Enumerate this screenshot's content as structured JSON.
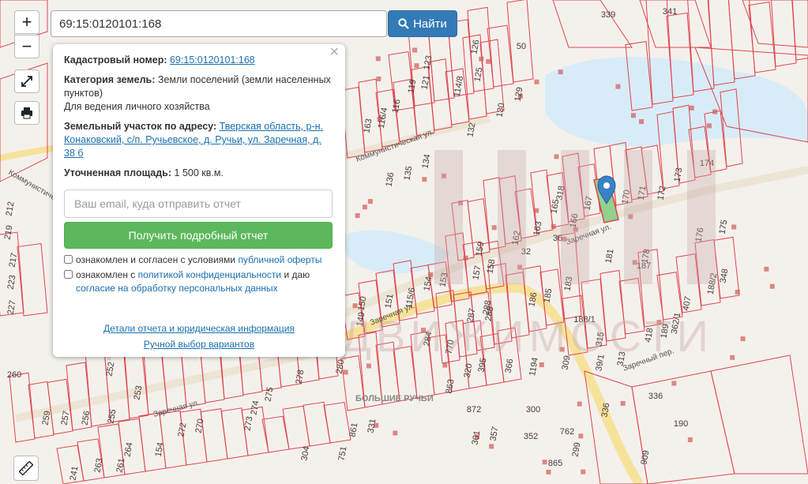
{
  "search": {
    "value": "69:15:0120101:168",
    "button_label": "Найти"
  },
  "controls": {
    "zoom_in": "+",
    "zoom_out": "−"
  },
  "popup": {
    "close_label": "×",
    "cadastral_label": "Кадастровый номер:",
    "cadastral_value": "69:15:0120101:168",
    "category_label": "Категория земель:",
    "category_value": "Земли поселений (земли населенных пунктов)",
    "use_value": "Для ведения личного хозяйства",
    "address_label": "Земельный участок по адресу:",
    "address_value": "Тверская область, р-н. Конаковский, с/п. Ручьевское, д. Ручьи, ул. Заречная, д. 38 б",
    "area_label": "Уточненная площадь:",
    "area_value": "1 500 кв.м.",
    "email_placeholder": "Ваш email, куда отправить отчет",
    "report_button": "Получить подробный отчет",
    "consent1_text": "ознакомлен и согласен с условиями",
    "consent1_link": "публичной оферты",
    "consent2_text": "ознакомлен с",
    "consent2_link": "политикой конфиденциальности",
    "consent2_mid": "и даю",
    "consent2_link2": "согласие на обработку персональных данных",
    "details_link": "Детали отчета и юридическая информация",
    "manual_link": "Ручной выбор вариантов"
  },
  "map": {
    "parcels": [
      "339",
      "341",
      "123",
      "126",
      "50",
      "121",
      "114/8",
      "125",
      "119",
      "116/4",
      "129",
      "116",
      "130",
      "163",
      "132",
      "135",
      "134",
      "136",
      "174",
      "173",
      "172",
      "171",
      "170",
      "167",
      "165",
      "318",
      "166",
      "162",
      "163",
      "36",
      "32",
      "159",
      "158",
      "157",
      "154",
      "153",
      "151",
      "150",
      "115/6",
      "149",
      "176",
      "175",
      "178",
      "181",
      "183",
      "185",
      "186",
      "187",
      "188/2",
      "348",
      "188/1",
      "189",
      "407",
      "362/1",
      "418",
      "309",
      "313",
      "336",
      "39/1",
      "315",
      "366",
      "1194",
      "288",
      "287",
      "288",
      "284",
      "770",
      "320",
      "395",
      "863",
      "872",
      "300",
      "301",
      "357",
      "352",
      "762",
      "865",
      "299",
      "336",
      "190",
      "909",
      "252",
      "260",
      "253",
      "259",
      "257",
      "256",
      "255",
      "219",
      "212",
      "223",
      "217",
      "227",
      "275",
      "274",
      "273",
      "270",
      "272",
      "154",
      "264",
      "263",
      "261",
      "278",
      "280",
      "861",
      "331",
      "304",
      "751",
      "241"
    ],
    "streets": [
      "Коммунистическая ул.",
      "Заречная ул.",
      "Заречная ул.",
      "Заречная ул.",
      "Заречный пер.",
      "Коммунистическая ул."
    ],
    "settlement": "БОЛЬШИЕ РУЧЬИ"
  },
  "watermark": {
    "line1": "ЦЕНТР НЕДВИЖИМОСТИ"
  },
  "colors": {
    "parcel_stroke": "#e0454f",
    "road": "#f6e29a",
    "water": "#d8ecf8",
    "selected_parcel": "#8fd18f",
    "marker": "#3b82c4"
  }
}
